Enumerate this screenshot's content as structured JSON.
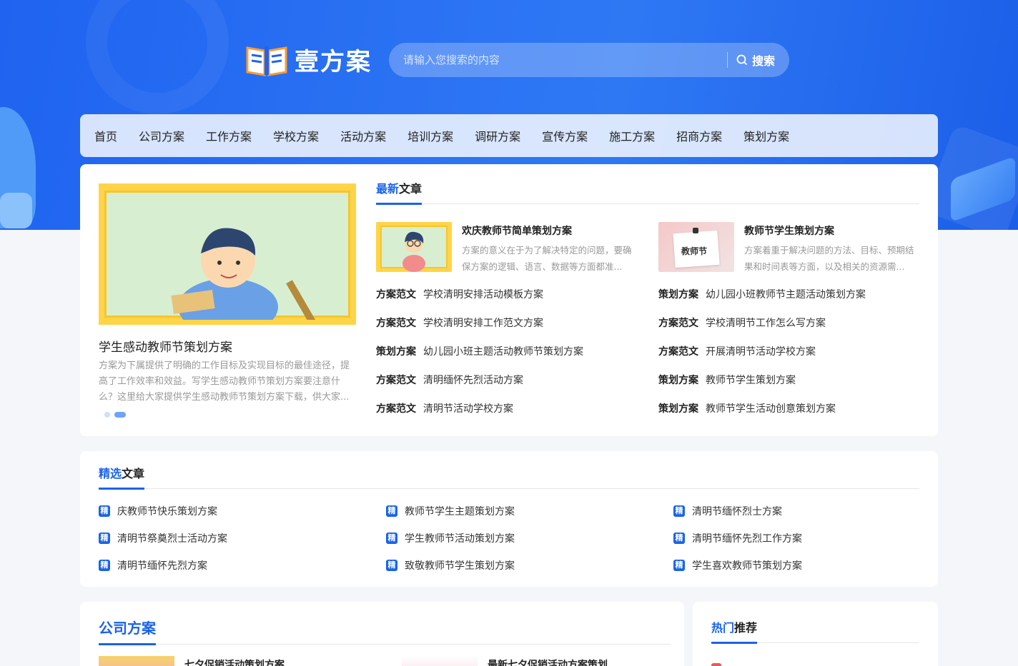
{
  "brand": {
    "name": "壹方案",
    "logo_icon": "open-book-icon"
  },
  "search": {
    "placeholder": "请输入您搜索的内容",
    "button_label": "搜索",
    "icon": "search-icon"
  },
  "nav": [
    {
      "label": "首页"
    },
    {
      "label": "公司方案"
    },
    {
      "label": "工作方案"
    },
    {
      "label": "学校方案"
    },
    {
      "label": "活动方案"
    },
    {
      "label": "培训方案"
    },
    {
      "label": "调研方案"
    },
    {
      "label": "宣传方案"
    },
    {
      "label": "施工方案"
    },
    {
      "label": "招商方案"
    },
    {
      "label": "策划方案"
    }
  ],
  "slider": {
    "title": "学生感动教师节策划方案",
    "desc": "方案为下属提供了明确的工作目标及实现目标的最佳途径，提高了工作效率和效益。写学生感动教师节策划方案要注意什么？这里给大家提供学生感动教师节策划方案下载，供大家..."
  },
  "latest": {
    "title_highlight": "最新",
    "title_rest": "文章",
    "featured": [
      {
        "title": "欢庆教师节简单策划方案",
        "desc": "方案的意义在于为了解决特定的问题，要确保方案的逻辑、语言、数据等方面都准..."
      },
      {
        "title": "教师节学生策划方案",
        "desc": "方案着重于解决问题的方法、目标、预期结果和时间表等方面，以及相关的资源需...",
        "img_text": "教师节"
      }
    ],
    "left_list": [
      {
        "cat": "方案范文",
        "title": "学校清明安排活动模板方案"
      },
      {
        "cat": "方案范文",
        "title": "学校清明安排工作范文方案"
      },
      {
        "cat": "策划方案",
        "title": "幼儿园小班主题活动教师节策划方案"
      },
      {
        "cat": "方案范文",
        "title": "清明缅怀先烈活动方案"
      },
      {
        "cat": "方案范文",
        "title": "清明节活动学校方案"
      }
    ],
    "right_list": [
      {
        "cat": "策划方案",
        "title": "幼儿园小班教师节主题活动策划方案"
      },
      {
        "cat": "方案范文",
        "title": "学校清明节工作怎么写方案"
      },
      {
        "cat": "方案范文",
        "title": "开展清明节活动学校方案"
      },
      {
        "cat": "策划方案",
        "title": "教师节学生策划方案"
      },
      {
        "cat": "策划方案",
        "title": "教师节学生活动创意策划方案"
      }
    ]
  },
  "picks": {
    "title_highlight": "精选",
    "title_rest": "文章",
    "badge": "精",
    "items": [
      "庆教师节快乐策划方案",
      "教师节学生主题策划方案",
      "清明节缅怀烈士方案",
      "清明节祭奠烈士活动方案",
      "学生教师节活动策划方案",
      "清明节缅怀先烈工作方案",
      "清明节缅怀先烈方案",
      "致敬教师节学生策划方案",
      "学生喜欢教师节策划方案"
    ]
  },
  "company": {
    "title": "公司方案",
    "items": [
      "七夕促销活动策划方案",
      "最新七夕促销活动方案策划"
    ]
  },
  "hot": {
    "title_highlight": "热门",
    "title_rest": "推荐"
  },
  "colors": {
    "accent": "#1a63e8",
    "hero": "#2a72f3"
  }
}
